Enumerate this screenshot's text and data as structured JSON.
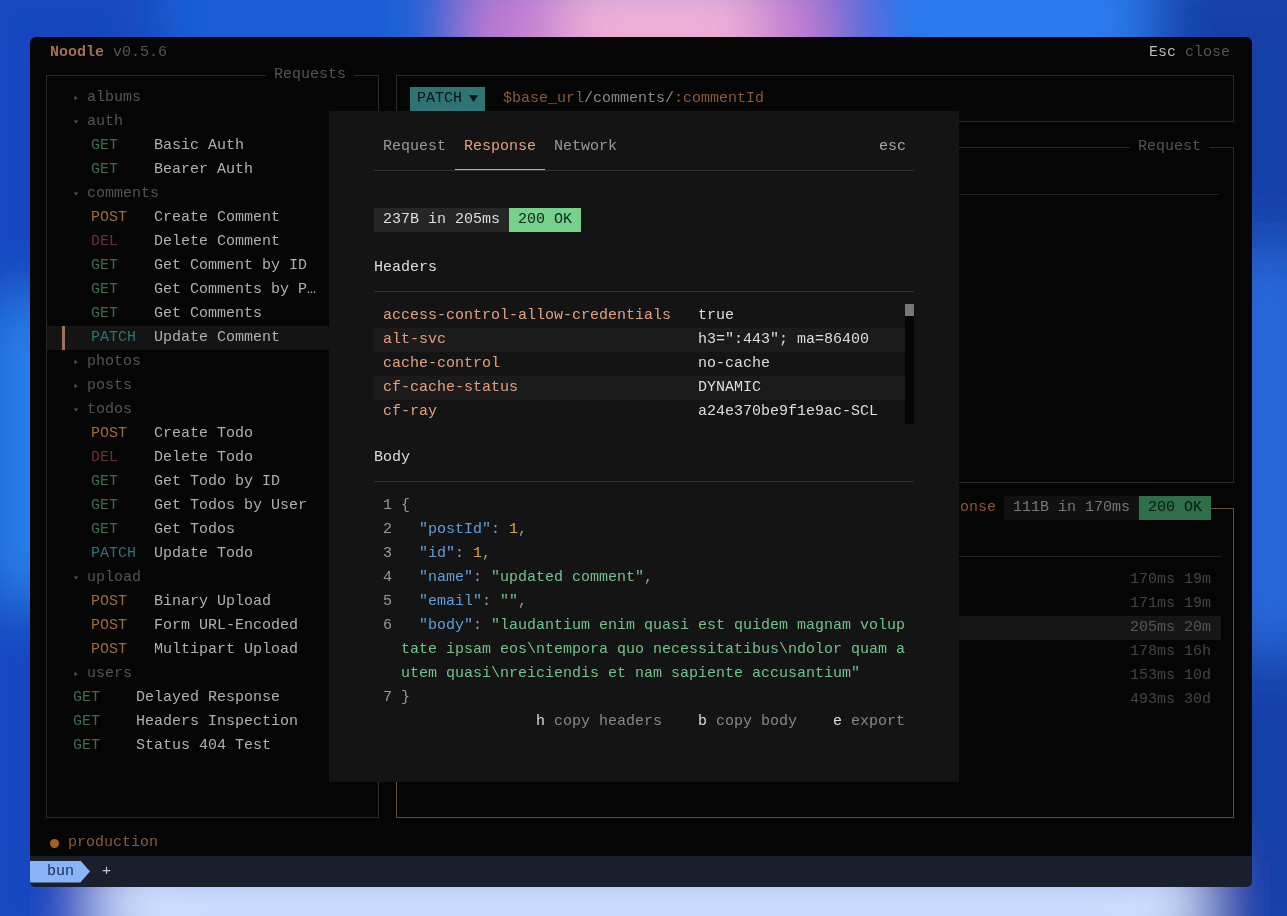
{
  "app": {
    "name": "Noodle",
    "version": "v0.5.6",
    "hint_key": "Esc",
    "hint_label": "close"
  },
  "sidebar": {
    "title": "Requests",
    "items": [
      {
        "kind": "folder",
        "name": "albums",
        "expanded": false,
        "selected": false
      },
      {
        "kind": "folder",
        "name": "auth",
        "expanded": true,
        "selected": false,
        "children": [
          {
            "kind": "request",
            "method": "GET",
            "color": "#3d6b4c",
            "name": "Basic Auth",
            "selected": false
          },
          {
            "kind": "request",
            "method": "GET",
            "color": "#3d6b4c",
            "name": "Bearer Auth",
            "selected": false
          }
        ]
      },
      {
        "kind": "folder",
        "name": "comments",
        "expanded": true,
        "selected": false,
        "children": [
          {
            "kind": "request",
            "method": "POST",
            "color": "#a26a35",
            "name": "Create Comment",
            "selected": false
          },
          {
            "kind": "request",
            "method": "DEL",
            "color": "#6e2f3a",
            "name": "Delete Comment",
            "selected": false
          },
          {
            "kind": "request",
            "method": "GET",
            "color": "#3d6b4c",
            "name": "Get Comment by ID",
            "selected": false
          },
          {
            "kind": "request",
            "method": "GET",
            "color": "#3d6b4c",
            "name": "Get Comments by P…",
            "selected": false
          },
          {
            "kind": "request",
            "method": "GET",
            "color": "#3d6b4c",
            "name": "Get Comments",
            "selected": false
          },
          {
            "kind": "request",
            "method": "PATCH",
            "color": "#2e7474",
            "name": "Update Comment",
            "selected": true
          }
        ]
      },
      {
        "kind": "folder",
        "name": "photos",
        "expanded": false,
        "selected": false
      },
      {
        "kind": "folder",
        "name": "posts",
        "expanded": false,
        "selected": false
      },
      {
        "kind": "folder",
        "name": "todos",
        "expanded": true,
        "selected": false,
        "children": [
          {
            "kind": "request",
            "method": "POST",
            "color": "#a26a35",
            "name": "Create Todo",
            "selected": false
          },
          {
            "kind": "request",
            "method": "DEL",
            "color": "#6e2f3a",
            "name": "Delete Todo",
            "selected": false
          },
          {
            "kind": "request",
            "method": "GET",
            "color": "#3d6b4c",
            "name": "Get Todo by ID",
            "selected": false
          },
          {
            "kind": "request",
            "method": "GET",
            "color": "#3d6b4c",
            "name": "Get Todos by User",
            "selected": false
          },
          {
            "kind": "request",
            "method": "GET",
            "color": "#3d6b4c",
            "name": "Get Todos",
            "selected": false
          },
          {
            "kind": "request",
            "method": "PATCH",
            "color": "#2e7474",
            "name": "Update Todo",
            "selected": false
          }
        ]
      },
      {
        "kind": "folder",
        "name": "upload",
        "expanded": true,
        "selected": false,
        "children": [
          {
            "kind": "request",
            "method": "POST",
            "color": "#a26a35",
            "name": "Binary Upload",
            "selected": false
          },
          {
            "kind": "request",
            "method": "POST",
            "color": "#a26a35",
            "name": "Form URL-Encoded",
            "selected": false
          },
          {
            "kind": "request",
            "method": "POST",
            "color": "#a26a35",
            "name": "Multipart Upload",
            "selected": false
          }
        ]
      },
      {
        "kind": "folder",
        "name": "users",
        "expanded": false,
        "selected": false
      },
      {
        "kind": "request",
        "method": "GET",
        "color": "#3d6b4c",
        "name": "Delayed Response",
        "selected": false
      },
      {
        "kind": "request",
        "method": "GET",
        "color": "#3d6b4c",
        "name": "Headers Inspection",
        "selected": false
      },
      {
        "kind": "request",
        "method": "GET",
        "color": "#3d6b4c",
        "name": "Status 404 Test",
        "selected": false
      }
    ]
  },
  "url_bar": {
    "method": "PATCH",
    "parts": [
      {
        "kind": "variable",
        "text": "$base_url"
      },
      {
        "kind": "path",
        "text": "/comments/"
      },
      {
        "kind": "variable",
        "text": ":commentId"
      }
    ]
  },
  "request_panel": {
    "title": "Request"
  },
  "response_panel": {
    "title": "onse",
    "size": "111B in 170ms",
    "status": "200 OK",
    "history": [
      {
        "duration": "170ms",
        "age": "19m",
        "selected": false
      },
      {
        "duration": "171ms",
        "age": "19m",
        "selected": false
      },
      {
        "duration": "205ms",
        "age": "20m",
        "selected": true
      },
      {
        "duration": "178ms",
        "age": "16h",
        "selected": false
      },
      {
        "duration": "153ms",
        "age": "10d",
        "selected": false
      },
      {
        "duration": "493ms",
        "age": "30d",
        "selected": false
      }
    ]
  },
  "environment": {
    "name": "production",
    "color": "#a0641e"
  },
  "terminal_tabs": [
    {
      "label": "bun",
      "selected": true
    }
  ],
  "new_tab": "+",
  "modal": {
    "tabs": [
      {
        "label": "Request",
        "selected": false
      },
      {
        "label": "Response",
        "selected": true
      },
      {
        "label": "Network",
        "selected": false
      }
    ],
    "close_hint": "esc",
    "size": "237B in 205ms",
    "status": "200 OK",
    "headers_title": "Headers",
    "headers": [
      {
        "name": "access-control-allow-credentials",
        "value": "true"
      },
      {
        "name": "alt-svc",
        "value": "h3=\":443\"; ma=86400"
      },
      {
        "name": "cache-control",
        "value": "no-cache"
      },
      {
        "name": "cf-cache-status",
        "value": "DYNAMIC"
      },
      {
        "name": "cf-ray",
        "value": "a24e370be9f1e9ac-SCL"
      }
    ],
    "body_title": "Body",
    "body_lines": [
      {
        "number": "1",
        "tokens": [
          {
            "kind": "punct",
            "text": "{"
          }
        ]
      },
      {
        "number": "2",
        "tokens": [
          {
            "kind": "key",
            "text": "  \"postId\""
          },
          {
            "kind": "punct",
            "text": ": "
          },
          {
            "kind": "number",
            "text": "1"
          },
          {
            "kind": "punct",
            "text": ","
          }
        ]
      },
      {
        "number": "3",
        "tokens": [
          {
            "kind": "key",
            "text": "  \"id\""
          },
          {
            "kind": "punct",
            "text": ": "
          },
          {
            "kind": "number",
            "text": "1"
          },
          {
            "kind": "punct",
            "text": ","
          }
        ]
      },
      {
        "number": "4",
        "tokens": [
          {
            "kind": "key",
            "text": "  \"name\""
          },
          {
            "kind": "punct",
            "text": ": "
          },
          {
            "kind": "string",
            "text": "\"updated comment\""
          },
          {
            "kind": "punct",
            "text": ","
          }
        ]
      },
      {
        "number": "5",
        "tokens": [
          {
            "kind": "key",
            "text": "  \"email\""
          },
          {
            "kind": "punct",
            "text": ": "
          },
          {
            "kind": "string",
            "text": "\"\""
          },
          {
            "kind": "punct",
            "text": ","
          }
        ]
      },
      {
        "number": "6",
        "tokens": [
          {
            "kind": "key",
            "text": "  \"body\""
          },
          {
            "kind": "punct",
            "text": ": "
          },
          {
            "kind": "string",
            "text": "\"laudantium enim quasi est quidem magnam voluptate ipsam eos\\ntempora quo necessitatibus\\ndolor quam autem quasi\\nreiciendis et nam sapiente accusantium\""
          }
        ]
      },
      {
        "number": "7",
        "tokens": [
          {
            "kind": "punct",
            "text": "}"
          }
        ]
      }
    ],
    "actions": [
      {
        "key": "h",
        "label": "copy headers"
      },
      {
        "key": "b",
        "label": "copy body"
      },
      {
        "key": "e",
        "label": "export"
      }
    ]
  }
}
